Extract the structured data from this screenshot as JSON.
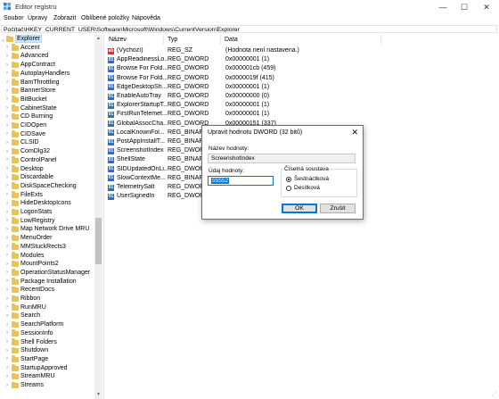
{
  "window": {
    "title": "Editor registru",
    "min_glyph": "—",
    "max_glyph": "☐",
    "close_glyph": "✕"
  },
  "menu": [
    "Soubor",
    "Úpravy",
    "Zobrazit",
    "Oblíbené položky",
    "Nápověda"
  ],
  "address": "Počítač\\HKEY_CURRENT_USER\\Software\\Microsoft\\Windows\\CurrentVersion\\Explorer",
  "tree": {
    "items": [
      {
        "label": "Explorer",
        "selected": true,
        "expanded": true
      },
      {
        "label": "Accent"
      },
      {
        "label": "Advanced"
      },
      {
        "label": "AppContract"
      },
      {
        "label": "AutoplayHandlers"
      },
      {
        "label": "BamThrottling"
      },
      {
        "label": "BannerStore"
      },
      {
        "label": "BitBucket"
      },
      {
        "label": "CabinetState"
      },
      {
        "label": "CD Burning"
      },
      {
        "label": "CIDOpen"
      },
      {
        "label": "CIDSave"
      },
      {
        "label": "CLSID"
      },
      {
        "label": "ComDlg32"
      },
      {
        "label": "ControlPanel"
      },
      {
        "label": "Desktop"
      },
      {
        "label": "Discardable"
      },
      {
        "label": "DiskSpaceChecking"
      },
      {
        "label": "FileExts"
      },
      {
        "label": "HideDesktopIcons"
      },
      {
        "label": "LogonStats"
      },
      {
        "label": "LowRegistry"
      },
      {
        "label": "Map Network Drive MRU"
      },
      {
        "label": "MenuOrder"
      },
      {
        "label": "MMStuckRects3"
      },
      {
        "label": "Modules"
      },
      {
        "label": "MountPoints2"
      },
      {
        "label": "OperationStatusManager"
      },
      {
        "label": "Package Installation"
      },
      {
        "label": "RecentDocs"
      },
      {
        "label": "Ribbon"
      },
      {
        "label": "RunMRU"
      },
      {
        "label": "Search"
      },
      {
        "label": "SearchPlatform"
      },
      {
        "label": "SessionInfo"
      },
      {
        "label": "Shell Folders"
      },
      {
        "label": "Shutdown"
      },
      {
        "label": "StartPage"
      },
      {
        "label": "StartupApproved"
      },
      {
        "label": "StreamMRU"
      },
      {
        "label": "Streams"
      }
    ]
  },
  "list": {
    "columns": [
      "Název",
      "Typ",
      "Data"
    ],
    "rows": [
      {
        "name": "(Výchozí)",
        "type": "REG_SZ",
        "data": "(Hodnota není nastavena.)",
        "icon": "sz"
      },
      {
        "name": "AppReadinessLo...",
        "type": "REG_DWORD",
        "data": "0x00000001 (1)",
        "icon": "bin"
      },
      {
        "name": "Browse For Fold...",
        "type": "REG_DWORD",
        "data": "0x000001cb (459)",
        "icon": "bin"
      },
      {
        "name": "Browse For Fold...",
        "type": "REG_DWORD",
        "data": "0x0000019f (415)",
        "icon": "bin"
      },
      {
        "name": "EdgeDesktopSh...",
        "type": "REG_DWORD",
        "data": "0x00000001 (1)",
        "icon": "bin"
      },
      {
        "name": "EnableAutoTray",
        "type": "REG_DWORD",
        "data": "0x00000000 (0)",
        "icon": "bin"
      },
      {
        "name": "ExplorerStartupT...",
        "type": "REG_DWORD",
        "data": "0x00000001 (1)",
        "icon": "bin"
      },
      {
        "name": "FirstRunTelemet...",
        "type": "REG_DWORD",
        "data": "0x00000001 (1)",
        "icon": "bin"
      },
      {
        "name": "GlobalAssocCha...",
        "type": "REG_DWORD",
        "data": "0x00000151 (337)",
        "icon": "bin"
      },
      {
        "name": "LocalKnownFol...",
        "type": "REG_BINARY",
        "data": "",
        "icon": "bin"
      },
      {
        "name": "PostAppInstallT...",
        "type": "REG_BINARY",
        "data": "",
        "icon": "bin"
      },
      {
        "name": "ScreenshotIndex",
        "type": "REG_DWORD",
        "data": "",
        "icon": "bin"
      },
      {
        "name": "ShellState",
        "type": "REG_BINARY",
        "data": "",
        "icon": "bin"
      },
      {
        "name": "SIDUpdatedOnLi...",
        "type": "REG_DWORD",
        "data": "",
        "icon": "bin"
      },
      {
        "name": "SlowContextMe...",
        "type": "REG_BINARY",
        "data": "",
        "icon": "bin"
      },
      {
        "name": "TelemetrySalt",
        "type": "REG_DWORD",
        "data": "",
        "icon": "bin"
      },
      {
        "name": "UserSignedIn",
        "type": "REG_DWORD",
        "data": "",
        "icon": "bin"
      }
    ]
  },
  "dialog": {
    "title": "Upravit hodnotu DWORD (32 bitů)",
    "name_label": "Název hodnoty:",
    "name_value": "ScreenshotIndex",
    "data_label": "Údaj hodnoty:",
    "data_value": "55552",
    "base_label": "Číselná soustava",
    "hex_label": "Šestnáctková",
    "dec_label": "Desítková",
    "hex_selected": true,
    "ok_label": "OK",
    "cancel_label": "Zrušit"
  }
}
